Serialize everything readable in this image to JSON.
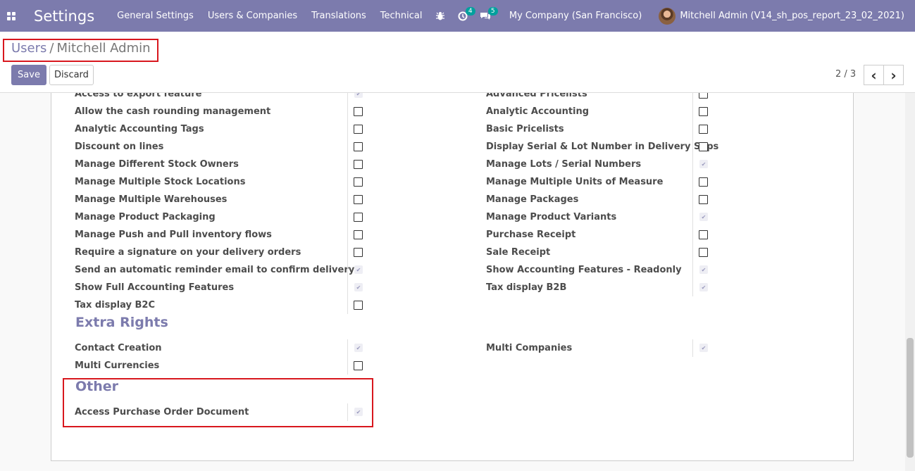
{
  "navbar": {
    "app_title": "Settings",
    "menu": [
      "General Settings",
      "Users & Companies",
      "Translations",
      "Technical"
    ],
    "activity_count": "4",
    "messages_count": "5",
    "company": "My Company (San Francisco)",
    "user": "Mitchell Admin (V14_sh_pos_report_23_02_2021)",
    "accent_color": "#7c7bad"
  },
  "control": {
    "breadcrumb_parent": "Users",
    "breadcrumb_sep": "/",
    "breadcrumb_current": "Mitchell Admin",
    "save_label": "Save",
    "discard_label": "Discard",
    "pager": "2 / 3",
    "prev_icon": "‹",
    "next_icon": "›"
  },
  "technical": {
    "left": [
      {
        "label": "Access to export feature",
        "checked": true
      },
      {
        "label": "Allow the cash rounding management",
        "checked": false
      },
      {
        "label": "Analytic Accounting Tags",
        "checked": false
      },
      {
        "label": "Discount on lines",
        "checked": false
      },
      {
        "label": "Manage Different Stock Owners",
        "checked": false
      },
      {
        "label": "Manage Multiple Stock Locations",
        "checked": false
      },
      {
        "label": "Manage Multiple Warehouses",
        "checked": false
      },
      {
        "label": "Manage Product Packaging",
        "checked": false
      },
      {
        "label": "Manage Push and Pull inventory flows",
        "checked": false
      },
      {
        "label": "Require a signature on your delivery orders",
        "checked": false
      },
      {
        "label": "Send an automatic reminder email to confirm delivery",
        "checked": true
      },
      {
        "label": "Show Full Accounting Features",
        "checked": true
      },
      {
        "label": "Tax display B2C",
        "checked": false
      }
    ],
    "right": [
      {
        "label": "Advanced Pricelists",
        "checked": false
      },
      {
        "label": "Analytic Accounting",
        "checked": false
      },
      {
        "label": "Basic Pricelists",
        "checked": false
      },
      {
        "label": "Display Serial & Lot Number in Delivery Slips",
        "checked": false
      },
      {
        "label": "Manage Lots / Serial Numbers",
        "checked": true
      },
      {
        "label": "Manage Multiple Units of Measure",
        "checked": false
      },
      {
        "label": "Manage Packages",
        "checked": false
      },
      {
        "label": "Manage Product Variants",
        "checked": true
      },
      {
        "label": "Purchase Receipt",
        "checked": false
      },
      {
        "label": "Sale Receipt",
        "checked": false
      },
      {
        "label": "Show Accounting Features - Readonly",
        "checked": true
      },
      {
        "label": "Tax display B2B",
        "checked": true
      }
    ]
  },
  "extra_rights": {
    "title": "Extra Rights",
    "left": [
      {
        "label": "Contact Creation",
        "checked": true
      },
      {
        "label": "Multi Currencies",
        "checked": false
      }
    ],
    "right": [
      {
        "label": "Multi Companies",
        "checked": true
      }
    ]
  },
  "other": {
    "title": "Other",
    "left": [
      {
        "label": "Access Purchase Order Document",
        "checked": true
      }
    ]
  },
  "checkmark_glyph": "✔"
}
